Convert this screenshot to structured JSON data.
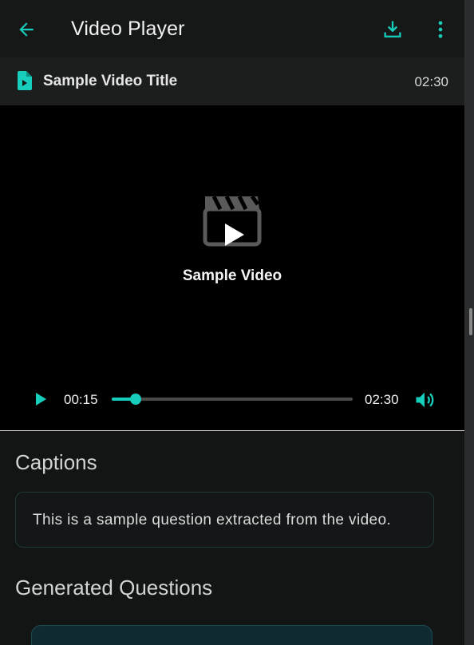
{
  "header": {
    "title": "Video Player",
    "back_icon": "arrow-left-icon",
    "download_icon": "download-icon",
    "more_icon": "more-vert-icon"
  },
  "file_info": {
    "icon": "video-file-icon",
    "title": "Sample Video Title",
    "duration": "02:30"
  },
  "player": {
    "placeholder_icon": "movie-clapper-play-icon",
    "placeholder_label": "Sample Video",
    "current_time": "00:15",
    "total_time": "02:30",
    "progress": 0.1,
    "play_icon": "play-icon",
    "volume_icon": "volume-icon"
  },
  "captions": {
    "heading": "Captions",
    "text": "This is a sample question extracted from the video."
  },
  "questions": {
    "heading": "Generated Questions"
  },
  "colors": {
    "accent": "#17cdbb",
    "background": "#131515",
    "appbar": "#161818",
    "player_bg": "#000000"
  }
}
